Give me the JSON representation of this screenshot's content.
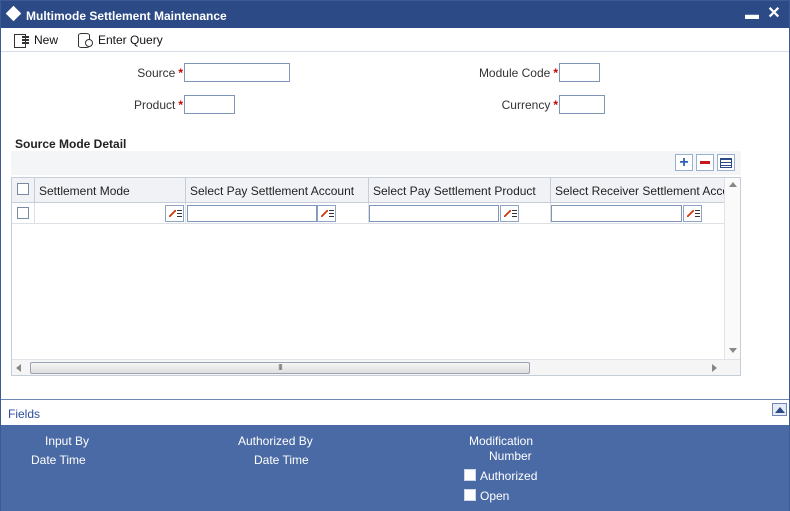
{
  "window": {
    "title": "Multimode Settlement Maintenance",
    "minimize_symbol": "▬",
    "close_symbol": "✕"
  },
  "toolbar": {
    "new_label": "New",
    "enter_query_label": "Enter Query"
  },
  "form": {
    "source_label": "Source",
    "product_label": "Product",
    "module_code_label": "Module Code",
    "currency_label": "Currency",
    "required_marker": "*",
    "source_value": "",
    "product_value": "",
    "module_code_value": "",
    "currency_value": ""
  },
  "source_mode_detail": {
    "title": "Source Mode Detail",
    "add_symbol": "+",
    "columns": [
      "Settlement Mode",
      "Select Pay Settlement Account",
      "Select Pay Settlement Product",
      "Select Receiver Settlement Account"
    ],
    "rows": [
      {
        "settlement_mode": "",
        "pay_account": "",
        "pay_product": "",
        "receiver_account": ""
      }
    ],
    "scroll_grip": "III"
  },
  "fields_bar": {
    "label": "Fields"
  },
  "audit": {
    "input_by": "Input By",
    "date_time_1": "Date Time",
    "authorized_by": "Authorized By",
    "date_time_2": "Date Time",
    "modification": "Modification",
    "number": "Number",
    "authorized": "Authorized",
    "open": "Open"
  },
  "colors": {
    "titlebar": "#2c4a86",
    "audit_background": "#4a6aa5",
    "required": "#cc0000",
    "link": "#2b4f9b"
  }
}
